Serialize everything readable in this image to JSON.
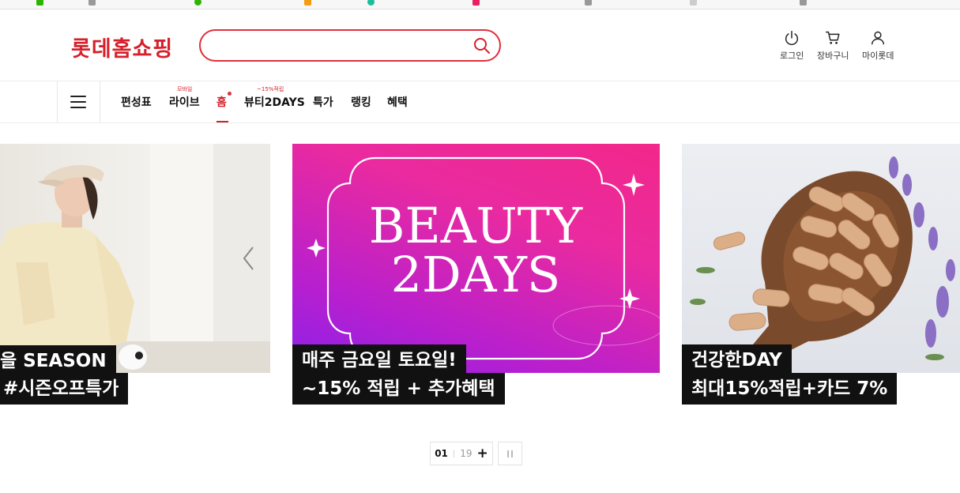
{
  "header": {
    "logo": "롯데홈쇼핑",
    "search_placeholder": "",
    "utils": [
      {
        "label": "로그인",
        "icon": "power-icon"
      },
      {
        "label": "장바구니",
        "icon": "cart-icon"
      },
      {
        "label": "마이롯데",
        "icon": "user-icon"
      }
    ]
  },
  "nav": {
    "items": [
      {
        "label": "편성표"
      },
      {
        "label": "라이브",
        "sup": "모바일"
      },
      {
        "label": "홈",
        "active": true
      },
      {
        "label": "뷰티2DAYS",
        "sup": "~15%적립"
      },
      {
        "label": "특가"
      },
      {
        "label": "랭킹"
      },
      {
        "label": "혜택"
      }
    ]
  },
  "banners": [
    {
      "line1": "을 SEASON",
      "line2": "#시즌오프특가"
    },
    {
      "line1": "매주 금요일 토요일!",
      "line2": "~15% 적립 + 추가혜택",
      "art_line1": "BEAUTY",
      "art_line2": "2DAYS"
    },
    {
      "line1": "건강한DAY",
      "line2": "최대15%적립+카드 7%"
    }
  ],
  "pager": {
    "current": "01",
    "total": "19",
    "plus": "+"
  },
  "colors": {
    "brand": "#d6202b",
    "banner_pink": "#f2288a",
    "banner_purple": "#8a22e8"
  }
}
